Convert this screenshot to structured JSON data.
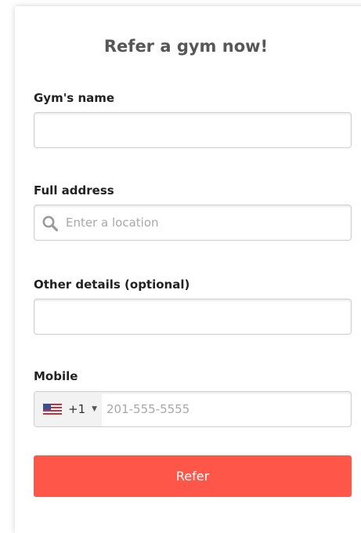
{
  "form": {
    "title": "Refer a gym now!",
    "gym_name": {
      "label": "Gym's name",
      "value": "",
      "placeholder": ""
    },
    "address": {
      "label": "Full address",
      "value": "",
      "placeholder": "Enter a location"
    },
    "details": {
      "label": "Other details (optional)",
      "value": "",
      "placeholder": ""
    },
    "mobile": {
      "label": "Mobile",
      "country_code": "+1",
      "country_icon": "us-flag-icon",
      "value": "",
      "placeholder": "201-555-5555"
    },
    "submit_label": "Refer"
  },
  "colors": {
    "accent": "#fe5648",
    "title": "#575757",
    "border": "#cfcfcf",
    "placeholder": "#a8a8a8"
  }
}
